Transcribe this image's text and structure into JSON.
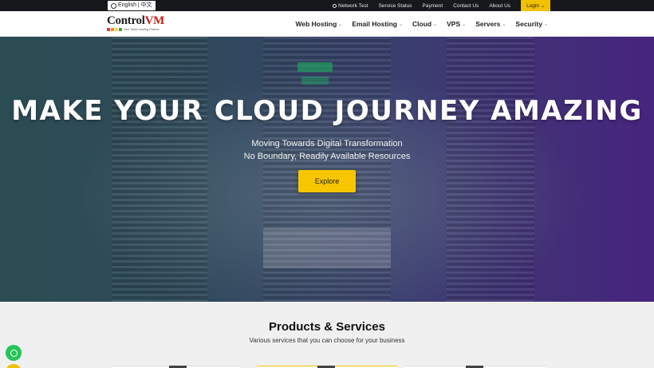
{
  "topbar": {
    "language": "English | 中文",
    "links": [
      "Network Test",
      "Service Status",
      "Payment",
      "Contact Us",
      "About Us"
    ],
    "login": "Login"
  },
  "logo": {
    "brand_a": "Control",
    "brand_b": "VM",
    "tagline": "Your Solid Hosting Partner",
    "dot_colors": [
      "#e53935",
      "#fb8c00",
      "#fdd835",
      "#43a047"
    ]
  },
  "nav": {
    "items": [
      "Web Hosting",
      "Email Hosting",
      "Cloud",
      "VPS",
      "Servers",
      "Security"
    ],
    "chevron": "⌄"
  },
  "hero": {
    "title": "MAKE YOUR CLOUD JOURNEY AMAZING",
    "subtitle1": "Moving Towards Digital Transformation",
    "subtitle2": "No Boundary, Readily Available Resources",
    "cta": "Explore"
  },
  "products": {
    "title": "Products & Services",
    "subtitle": "Various services that you can choose for your business"
  },
  "colors": {
    "accent": "#f7c600",
    "topbar": "#16181c",
    "whatsapp": "#25c55a"
  }
}
